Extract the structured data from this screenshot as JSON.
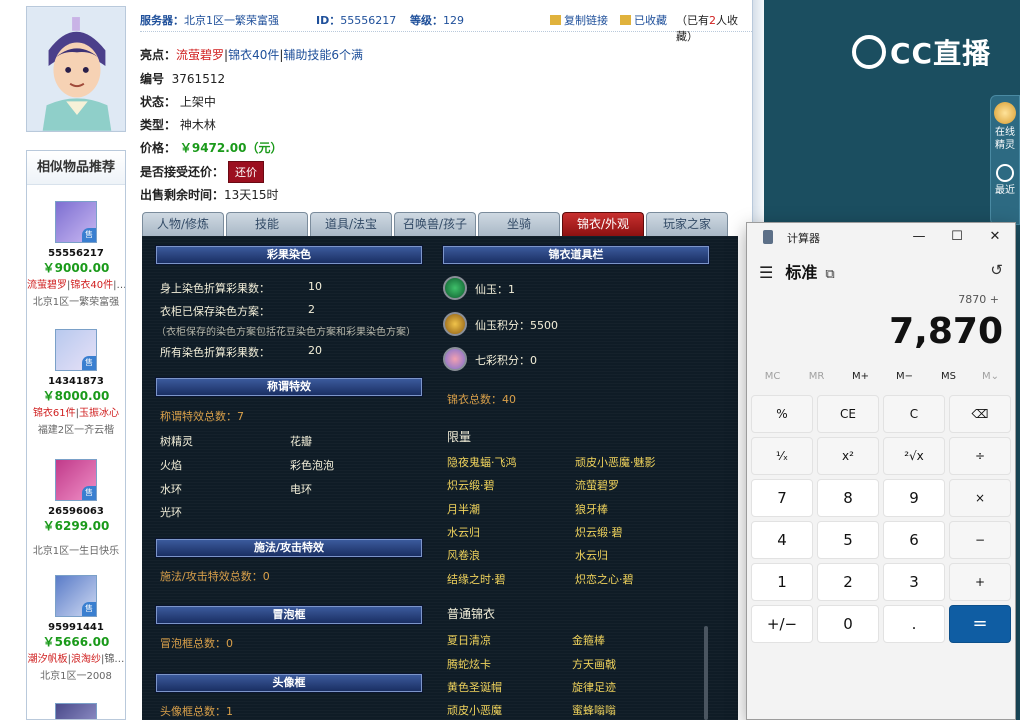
{
  "header": {
    "server_label": "服务器：",
    "server_value": "北京1区一繁荣富强",
    "id_label": "ID：",
    "id_value": "55556217",
    "level_label": "等级：",
    "level_value": "129",
    "copy_link": "复制链接",
    "favorited": "已收藏",
    "fav_prefix": "（已有",
    "fav_count": "2",
    "fav_suffix": "人收藏）"
  },
  "info": {
    "highlights_label": "亮点：",
    "highlight_1": "流萤碧罗",
    "highlight_2": "锦衣40件",
    "highlight_3": "辅助技能6个满",
    "sep": "|",
    "serial_label": "编号",
    "serial_value": "3761512",
    "status_label": "状态：",
    "status_value": "上架中",
    "type_label": "类型：",
    "type_value": "神木林",
    "price_label": "价格：",
    "price_value": "￥9472.00（元）",
    "bargain_label": "是否接受还价：",
    "bargain_button": "还价",
    "remaining_label": "出售剩余时间：",
    "remaining_value": "13天15时"
  },
  "similar": {
    "title": "相似物品推荐",
    "sell_badge": "售",
    "items": [
      {
        "id": "55556217",
        "price": "￥9000.00",
        "tag1": "流萤碧罗",
        "sep": "|",
        "tag2": "锦衣40件",
        "tag3": "|…",
        "server": "北京1区一繁荣富强"
      },
      {
        "id": "14341873",
        "price": "￥8000.00",
        "tag1": "锦衣61件",
        "sep": "|",
        "tag2": "玉振冰心",
        "tag3": "",
        "server": "福建2区一齐云楷"
      },
      {
        "id": "26596063",
        "price": "￥6299.00",
        "tag1": "",
        "sep": "",
        "tag2": "",
        "tag3": "",
        "server": "北京1区一生日快乐"
      },
      {
        "id": "95991441",
        "price": "￥5666.00",
        "tag1": "潮汐帆板",
        "sep": "|",
        "tag2": "浪淘纱",
        "tag3": "|锦…",
        "server": "北京1区一2008"
      }
    ]
  },
  "tabs": [
    "人物/修炼",
    "技能",
    "道具/法宝",
    "召唤兽/孩子",
    "坐骑",
    "锦衣/外观",
    "玩家之家"
  ],
  "panel": {
    "dye_title": "彩果染色",
    "dye_1_label": "身上染色折算彩果数：",
    "dye_1_value": "10",
    "dye_2_label": "衣柜已保存染色方案：",
    "dye_2_value": "2",
    "dye_note": "（衣柜保存的染色方案包括花豆染色方案和彩果染色方案）",
    "dye_3_label": "所有染色折算彩果数：",
    "dye_3_value": "20",
    "title_effect_title": "称谓特效",
    "title_effect_total": "称谓特效总数：7",
    "title_effects": [
      "树精灵",
      "花瓣",
      "火焰",
      "彩色泡泡",
      "水环",
      "电环",
      "光环"
    ],
    "cast_title": "施法/攻击特效",
    "cast_total": "施法/攻击特效总数：0",
    "bubble_title": "冒泡框",
    "bubble_total": "冒泡框总数：0",
    "avatar_frame_title": "头像框",
    "avatar_frame_total": "头像框总数：1",
    "outfit_title": "锦衣道具栏",
    "jade_label": "仙玉：1",
    "jade_points_label": "仙玉积分：5500",
    "rainbow_points_label": "七彩积分：0",
    "outfit_total": "锦衣总数：40",
    "limited_label": "限量",
    "limited_items": [
      "隐夜鬼蝠·飞鸿",
      "顽皮小恶魔·魅影",
      "炽云缎·碧",
      "流萤碧罗",
      "月半潮",
      "狼牙棒",
      "水云归",
      "炽云缎·碧",
      "风卷浪",
      "水云归",
      "结缘之时·碧",
      "炽恋之心·碧"
    ],
    "normal_label": "普通锦衣",
    "normal_items": [
      "夏日清凉",
      "金箍棒",
      "腾蛇炫卡",
      "方天画戟",
      "黄色圣诞帽",
      "旋律足迹",
      "顽皮小恶魔",
      "蜜蜂嗡嗡"
    ]
  },
  "video": {
    "logo_text": "CC直播",
    "side_1": "在线精灵",
    "side_2": "最近"
  },
  "calculator": {
    "title": "计算器",
    "mode": "标准",
    "expression": "7870 +",
    "display": "7,870",
    "memory": [
      "MC",
      "MR",
      "M+",
      "M−",
      "MS",
      "M⌄"
    ],
    "keys": [
      "%",
      "CE",
      "C",
      "⌫",
      "¹⁄ₓ",
      "x²",
      "²√x",
      "÷",
      "7",
      "8",
      "9",
      "×",
      "4",
      "5",
      "6",
      "−",
      "1",
      "2",
      "3",
      "+",
      "+/−",
      "0",
      ".",
      "="
    ]
  },
  "colors": {
    "accent_blue": "#1e4f9a",
    "price_green": "#1a9a1a",
    "tag_red": "#d02020",
    "tab_active": "#a81c1c",
    "panel_bg": "#0f1c26",
    "equals_blue": "#0f5da3",
    "video_bg": "#1b4e60"
  },
  "icons": [
    "link-icon",
    "star-folder-icon",
    "menu-icon",
    "keep-on-top-icon",
    "history-icon",
    "jade-icon",
    "jade-points-icon",
    "rainbow-icon",
    "sprite-icon",
    "clock-icon"
  ]
}
